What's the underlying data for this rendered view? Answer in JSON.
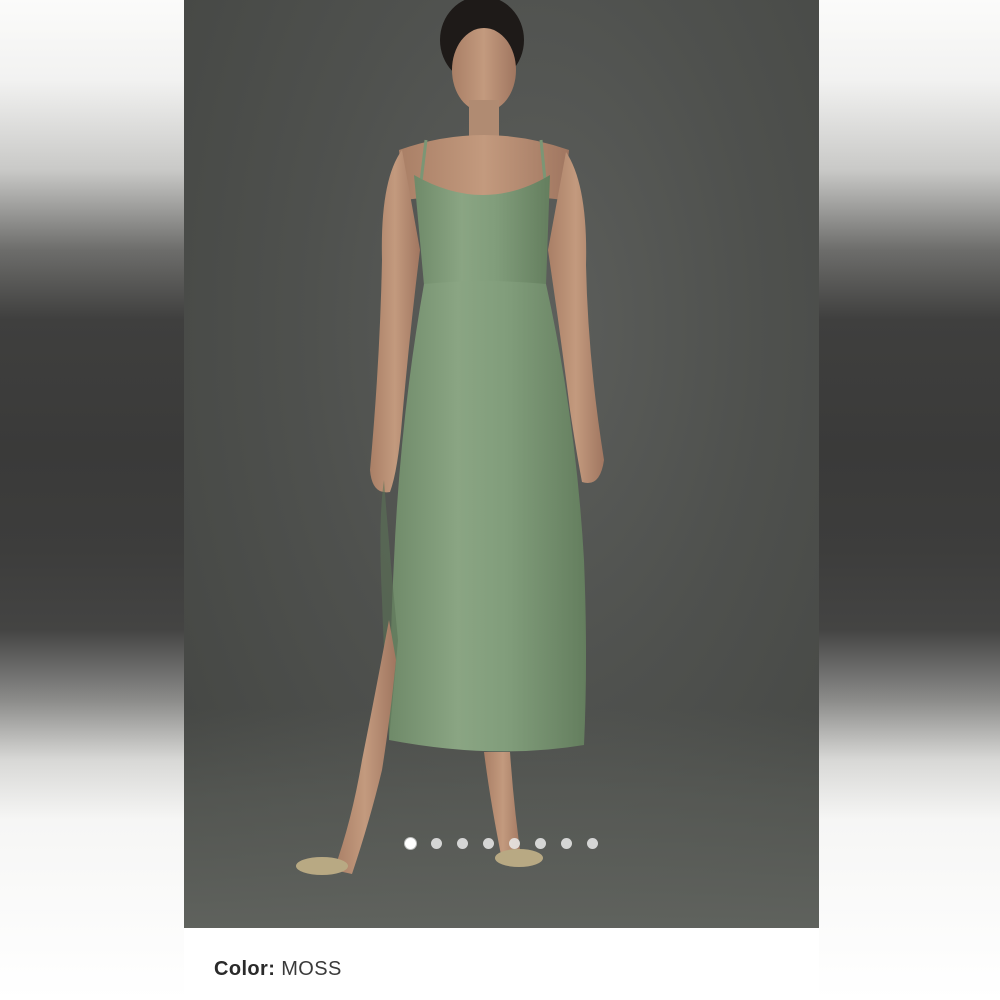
{
  "product": {
    "color_label": "Color:",
    "color_value": "MOSS",
    "dress_color": "#7f9a79"
  },
  "carousel": {
    "total_images": 8,
    "active_index": 0
  }
}
